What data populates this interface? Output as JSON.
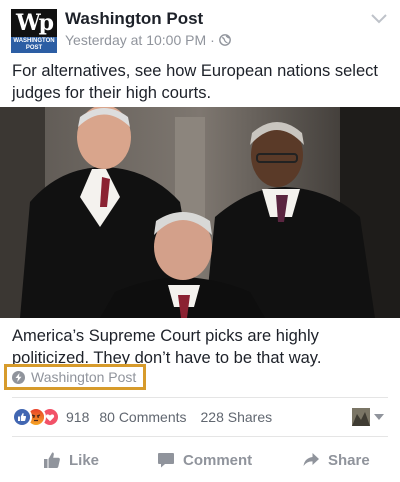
{
  "post": {
    "page_name": "Washington Post",
    "timestamp": "Yesterday at 10:00 PM",
    "separator": "·",
    "message": "For alternatives, see how European nations select judges for their high courts.",
    "avatar": {
      "mark": "ꟽp",
      "band_line1": "WASHINGTON",
      "band_line2": "POST"
    },
    "link": {
      "title": "America’s Supreme Court picks are highly politicized. They don’t have to be that way.",
      "source": "Washington Post"
    },
    "reactions": {
      "types": [
        "like-icon",
        "angry-icon",
        "love-icon"
      ],
      "count": "918",
      "comments": "80 Comments",
      "shares": "228 Shares"
    },
    "actions": {
      "like": "Like",
      "comment": "Comment",
      "share": "Share"
    }
  },
  "colors": {
    "text_primary": "#1d2129",
    "text_secondary": "#90949c",
    "like_blue": "#4267b2",
    "angry_orange": "#f5a623",
    "love_red": "#f25268",
    "source_highlight": "#d79b2b"
  }
}
